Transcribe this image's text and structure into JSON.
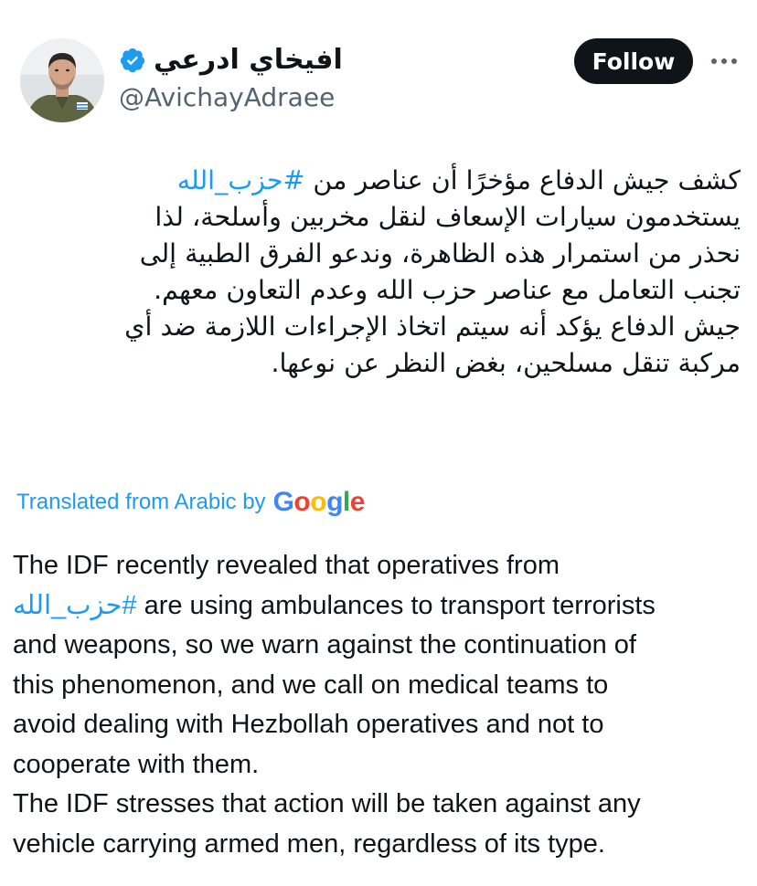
{
  "author": {
    "display_name": "افيخاي ادرعي",
    "handle": "@AvichayAdraee",
    "avatar_icon": "profile-photo-man-in-military-uniform",
    "verified_icon": "verified-badge-icon"
  },
  "actions": {
    "follow_label": "Follow",
    "more_icon": "more-options-icon"
  },
  "tweet": {
    "arabic_lines": [
      {
        "pre": "كشف جيش الدفاع مؤخرًا أن عناصر من ",
        "hashtag": "#حزب_الله",
        "post": ""
      },
      {
        "pre": "يستخدمون سيارات الإسعاف لنقل مخربين وأسلحة، لذا",
        "hashtag": "",
        "post": ""
      },
      {
        "pre": "نحذر من استمرار هذه الظاهرة، وندعو الفرق الطبية إلى",
        "hashtag": "",
        "post": ""
      },
      {
        "pre": "تجنب التعامل مع عناصر حزب الله وعدم التعاون معهم.",
        "hashtag": "",
        "post": ""
      },
      {
        "pre": "جيش الدفاع يؤكد أنه سيتم اتخاذ الإجراءات اللازمة ضد أي",
        "hashtag": "",
        "post": ""
      },
      {
        "pre": "مركبة تنقل مسلحين، بغض النظر عن نوعها.",
        "hashtag": "",
        "post": ""
      }
    ],
    "translation_label": "Translated from Arabic by",
    "google_letters": [
      "G",
      "o",
      "o",
      "g",
      "l",
      "e"
    ],
    "google_colors": [
      "#4285F4",
      "#EA4335",
      "#FBBC05",
      "#4285F4",
      "#34A853",
      "#EA4335"
    ],
    "english_lines": [
      {
        "pre": "The IDF recently revealed that operatives from",
        "hashtag": "",
        "post": ""
      },
      {
        "pre": "",
        "hashtag": "#حزب_الله",
        "post": " are using ambulances to transport terrorists"
      },
      {
        "pre": "and weapons, so we warn against the continuation of",
        "hashtag": "",
        "post": ""
      },
      {
        "pre": "this phenomenon, and we call on medical teams to",
        "hashtag": "",
        "post": ""
      },
      {
        "pre": "avoid dealing with Hezbollah operatives and not to",
        "hashtag": "",
        "post": ""
      },
      {
        "pre": "cooperate with them.",
        "hashtag": "",
        "post": ""
      },
      {
        "pre": "The IDF stresses that action will be taken against any",
        "hashtag": "",
        "post": ""
      },
      {
        "pre": "vehicle carrying armed men, regardless of its type.",
        "hashtag": "",
        "post": ""
      }
    ]
  },
  "colors": {
    "link": "#1d9bf0",
    "text": "#0f1419",
    "secondary": "#536471",
    "follow_bg": "#0f1419"
  }
}
